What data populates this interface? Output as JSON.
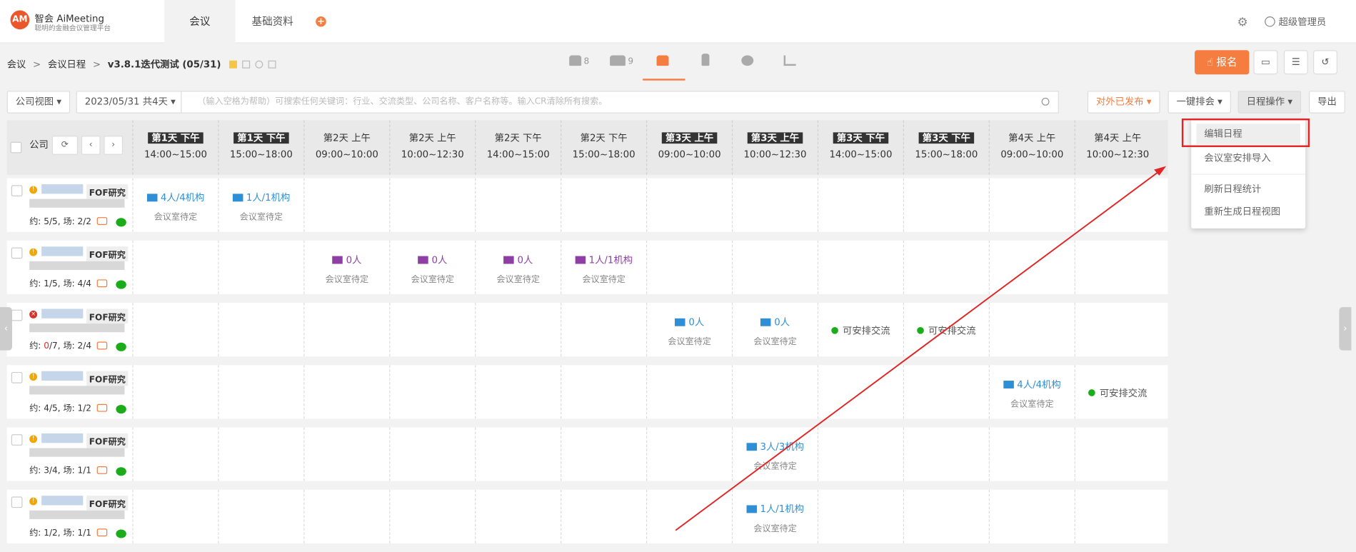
{
  "app": {
    "logo_text": "AM",
    "name": "智会 AiMeeting",
    "subtitle": "聪明的金融会议管理平台"
  },
  "topnav": {
    "tabs": [
      {
        "label": "会议"
      },
      {
        "label": "基础资料"
      }
    ],
    "add_icon": "plus-circle-icon"
  },
  "header_right": {
    "settings_icon": "gear-icon",
    "user_icon": "user-icon",
    "user": "超级管理员"
  },
  "breadcrumb": {
    "items": [
      "会议",
      "会议日程"
    ],
    "current": "v3.8.1迭代测试 (05/31)"
  },
  "mid_icons": [
    {
      "icon": "person-icon",
      "count": "8"
    },
    {
      "icon": "group-icon",
      "count": "9"
    },
    {
      "icon": "calendar-icon",
      "count": ""
    },
    {
      "icon": "building-icon",
      "count": ""
    },
    {
      "icon": "webcam-icon",
      "count": ""
    },
    {
      "icon": "bar-chart-icon",
      "count": ""
    }
  ],
  "actions": {
    "signup": "报名",
    "monitor_icon": "monitor-icon",
    "filter_icon": "sliders-icon",
    "history_icon": "history-icon"
  },
  "filters": {
    "view": "公司视图 ▾",
    "date": "2023/05/31 共4天 ▾",
    "search_placeholder": "（输入空格为帮助）可搜索任何关键词：行业、交流类型、公司名称、客户名称等。输入CR清除所有搜索。",
    "published": "对外已发布",
    "one_key": "一键排会",
    "schedule_ops": "日程操作",
    "export": "导出"
  },
  "table": {
    "company_header": "公司",
    "columns": [
      {
        "day": "第1天 下午",
        "time": "14:00~15:00",
        "dark": true
      },
      {
        "day": "第1天 下午",
        "time": "15:00~18:00",
        "dark": true
      },
      {
        "day": "第2天 上午",
        "time": "09:00~10:00",
        "dark": false
      },
      {
        "day": "第2天 上午",
        "time": "10:00~12:30",
        "dark": false
      },
      {
        "day": "第2天 下午",
        "time": "14:00~15:00",
        "dark": false
      },
      {
        "day": "第2天 下午",
        "time": "15:00~18:00",
        "dark": false
      },
      {
        "day": "第3天 上午",
        "time": "09:00~10:00",
        "dark": true
      },
      {
        "day": "第3天 上午",
        "time": "10:00~12:30",
        "dark": true
      },
      {
        "day": "第3天 下午",
        "time": "14:00~15:00",
        "dark": true
      },
      {
        "day": "第3天 下午",
        "time": "15:00~18:00",
        "dark": true
      },
      {
        "day": "第4天 上午",
        "time": "09:00~10:00",
        "dark": false
      },
      {
        "day": "第4天 上午",
        "time": "10:00~12:30",
        "dark": false
      }
    ],
    "rows": [
      {
        "status": "warn",
        "tag": "FOF研究",
        "yue": "5/5",
        "chang": "2/2",
        "cells": {
          "0": {
            "type": "meet",
            "color": "blue",
            "count": "4人/4机构",
            "room": "会议室待定"
          },
          "1": {
            "type": "meet",
            "color": "blue",
            "count": "1人/1机构",
            "room": "会议室待定"
          }
        }
      },
      {
        "status": "warn",
        "tag": "FOF研究",
        "yue": "1/5",
        "chang": "4/4",
        "cells": {
          "2": {
            "type": "meet",
            "color": "purple",
            "count": "0人",
            "room": "会议室待定"
          },
          "3": {
            "type": "meet",
            "color": "purple",
            "count": "0人",
            "room": "会议室待定"
          },
          "4": {
            "type": "meet",
            "color": "purple",
            "count": "0人",
            "room": "会议室待定"
          },
          "5": {
            "type": "meet",
            "color": "purple",
            "count": "1人/1机构",
            "room": "会议室待定"
          }
        }
      },
      {
        "status": "error",
        "tag": "FOF研究",
        "yue_red": "0",
        "yue_rest": "/7",
        "chang": "2/4",
        "cells": {
          "6": {
            "type": "meet",
            "color": "blue",
            "count": "0人",
            "room": "会议室待定"
          },
          "7": {
            "type": "meet",
            "color": "blue",
            "count": "0人",
            "room": "会议室待定"
          },
          "8": {
            "type": "avail",
            "label": "可安排交流"
          },
          "9": {
            "type": "avail",
            "label": "可安排交流"
          }
        }
      },
      {
        "status": "warn",
        "tag": "FOF研究",
        "yue": "4/5",
        "chang": "1/2",
        "cells": {
          "10": {
            "type": "meet",
            "color": "blue",
            "count": "4人/4机构",
            "room": "会议室待定"
          },
          "11": {
            "type": "avail",
            "label": "可安排交流"
          }
        }
      },
      {
        "status": "warn",
        "tag": "FOF研究",
        "yue": "3/4",
        "chang": "1/1",
        "cells": {
          "7": {
            "type": "meet",
            "color": "blue",
            "count": "3人/3机构",
            "room": "会议室待定"
          }
        }
      },
      {
        "status": "warn",
        "tag": "FOF研究",
        "yue": "1/2",
        "chang": "1/1",
        "cells": {
          "7": {
            "type": "meet",
            "color": "blue",
            "count": "1人/1机构",
            "room": "会议室待定"
          }
        }
      }
    ]
  },
  "dropdown": {
    "items": [
      "编辑日程",
      "会议室安排导入",
      "刷新日程统计",
      "重新生成日程视图"
    ]
  },
  "labels": {
    "yue": "约: ",
    "chang": ", 场: "
  }
}
